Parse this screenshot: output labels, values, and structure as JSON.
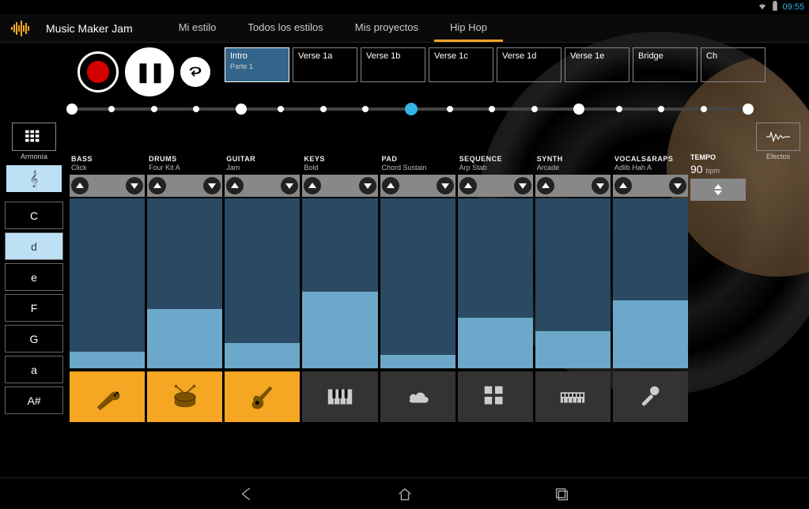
{
  "status": {
    "time": "09:55"
  },
  "app": {
    "title": "Music Maker Jam"
  },
  "nav": [
    {
      "label": "Mi estilo",
      "active": false
    },
    {
      "label": "Todos los estilos",
      "active": false
    },
    {
      "label": "Mis proyectos",
      "active": false
    },
    {
      "label": "Hip Hop",
      "active": true
    }
  ],
  "parts": [
    {
      "label": "Intro",
      "sub": "Parte 1",
      "active": true
    },
    {
      "label": "Verse 1a",
      "active": false
    },
    {
      "label": "Verse 1b",
      "active": false
    },
    {
      "label": "Verse 1c",
      "active": false
    },
    {
      "label": "Verse 1d",
      "active": false
    },
    {
      "label": "Verse 1e",
      "active": false
    },
    {
      "label": "Bridge",
      "active": false
    },
    {
      "label": "Ch",
      "active": false
    }
  ],
  "left_util": {
    "label": "Armonía"
  },
  "right_util": {
    "label": "Efectos"
  },
  "timeline": {
    "markers": 17,
    "bigEvery": 4,
    "current": 8
  },
  "chords": [
    {
      "label": "C",
      "active": false
    },
    {
      "label": "d",
      "active": true
    },
    {
      "label": "e",
      "active": false
    },
    {
      "label": "F",
      "active": false
    },
    {
      "label": "G",
      "active": false
    },
    {
      "label": "a",
      "active": false
    },
    {
      "label": "A#",
      "active": false
    }
  ],
  "tracks": [
    {
      "name": "BASS",
      "preset": "Click",
      "vol": 10,
      "hl": true,
      "icon": "bass"
    },
    {
      "name": "DRUMS",
      "preset": "Four Kit A",
      "vol": 35,
      "hl": true,
      "icon": "drums"
    },
    {
      "name": "GUITAR",
      "preset": "Jam",
      "vol": 15,
      "hl": true,
      "icon": "guitar"
    },
    {
      "name": "KEYS",
      "preset": "Bold",
      "vol": 45,
      "hl": false,
      "icon": "keys"
    },
    {
      "name": "PAD",
      "preset": "Chord Sustain",
      "vol": 8,
      "hl": false,
      "icon": "pad"
    },
    {
      "name": "SEQUENCE",
      "preset": "Arp Stab",
      "vol": 30,
      "hl": false,
      "icon": "seq"
    },
    {
      "name": "SYNTH",
      "preset": "Arcade",
      "vol": 22,
      "hl": false,
      "icon": "synth"
    },
    {
      "name": "VOCALS&RAPS",
      "preset": "Adlib Hah A",
      "vol": 40,
      "hl": false,
      "icon": "vocals"
    }
  ],
  "tempo": {
    "label": "TEMPO",
    "value": "90",
    "unit": "bpm"
  }
}
